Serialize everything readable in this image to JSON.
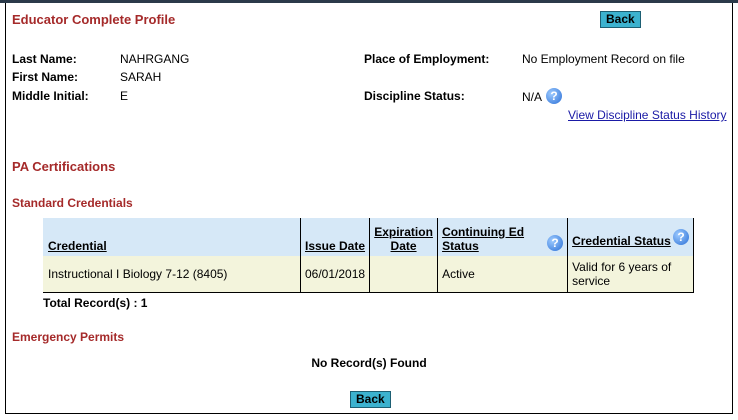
{
  "page": {
    "title": "Educator Complete Profile",
    "back_label": "Back"
  },
  "profile": {
    "last_name_label": "Last Name:",
    "last_name": "NAHRGANG",
    "first_name_label": "First Name:",
    "first_name": "SARAH",
    "middle_initial_label": "Middle Initial:",
    "middle_initial": "E",
    "employment_label": "Place of Employment:",
    "employment": "No Employment Record on file",
    "discipline_label": "Discipline Status:",
    "discipline": "N/A",
    "discipline_history_link": "View Discipline Status History"
  },
  "certifications": {
    "heading": "PA Certifications",
    "standard_heading": "Standard Credentials",
    "columns": {
      "credential": "Credential",
      "issue_date": "Issue Date",
      "expiration_line1": "Expiration",
      "expiration_line2": "Date",
      "continuing_line1": "Continuing Ed",
      "continuing_line2": "Status",
      "credential_status": "Credential Status"
    },
    "rows": [
      {
        "credential": "Instructional I Biology 7-12 (8405)",
        "issue_date": "06/01/2018",
        "expiration_date": "",
        "continuing_ed": "Active",
        "status": "Valid for 6 years of service"
      }
    ],
    "total_records": "Total Record(s) : 1"
  },
  "emergency": {
    "heading": "Emergency Permits",
    "empty_message": "No Record(s) Found"
  },
  "icons": {
    "help": "help-icon",
    "help_glyph": "?"
  },
  "colors": {
    "heading": "#a52a2a",
    "button": "#3cb2cf",
    "table_header": "#d6e8f7",
    "table_row": "#f3f4dc",
    "link": "#1a1aa6"
  }
}
